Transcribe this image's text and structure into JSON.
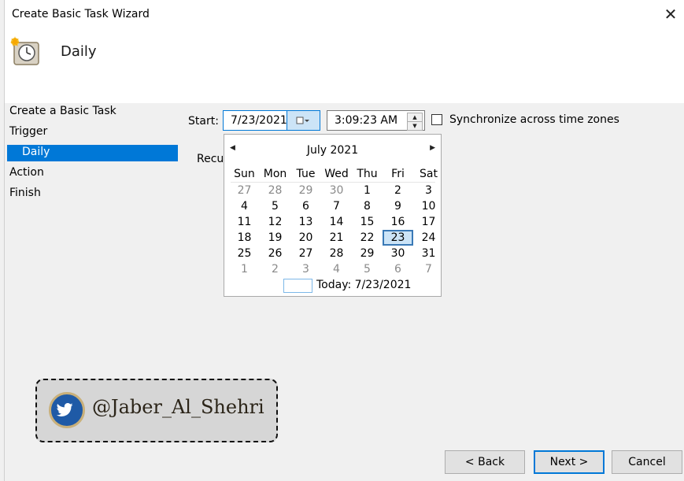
{
  "window": {
    "title": "Create Basic Task Wizard"
  },
  "header": {
    "page_title": "Daily"
  },
  "nav": {
    "items": [
      {
        "label": "Create a Basic Task"
      },
      {
        "label": "Trigger"
      },
      {
        "label": "Daily",
        "selected": true
      },
      {
        "label": "Action"
      },
      {
        "label": "Finish"
      }
    ]
  },
  "form": {
    "start_label": "Start:",
    "start_date": "7/23/2021",
    "start_time": "3:09:23 AM",
    "sync_label": "Synchronize across time zones",
    "sync_checked": false,
    "recur_label_partial": "Recu"
  },
  "calendar": {
    "month_title": "July 2021",
    "weekdays": [
      "Sun",
      "Mon",
      "Tue",
      "Wed",
      "Thu",
      "Fri",
      "Sat"
    ],
    "weeks": [
      [
        "27",
        "28",
        "29",
        "30",
        "1",
        "2",
        "3"
      ],
      [
        "4",
        "5",
        "6",
        "7",
        "8",
        "9",
        "10"
      ],
      [
        "11",
        "12",
        "13",
        "14",
        "15",
        "16",
        "17"
      ],
      [
        "18",
        "19",
        "20",
        "21",
        "22",
        "23",
        "24"
      ],
      [
        "25",
        "26",
        "27",
        "28",
        "29",
        "30",
        "31"
      ],
      [
        "1",
        "2",
        "3",
        "4",
        "5",
        "6",
        "7"
      ]
    ],
    "selected": "23",
    "today_text": "Today: 7/23/2021"
  },
  "buttons": {
    "back": "< Back",
    "next": "Next >",
    "cancel": "Cancel"
  },
  "watermark": {
    "handle": "@Jaber_Al_Shehri"
  },
  "colors": {
    "accent": "#0078d7",
    "selection_bg": "#cce4f7",
    "dialog_bg": "#f0f0f0",
    "twitter_blue": "#1f5aa6"
  }
}
